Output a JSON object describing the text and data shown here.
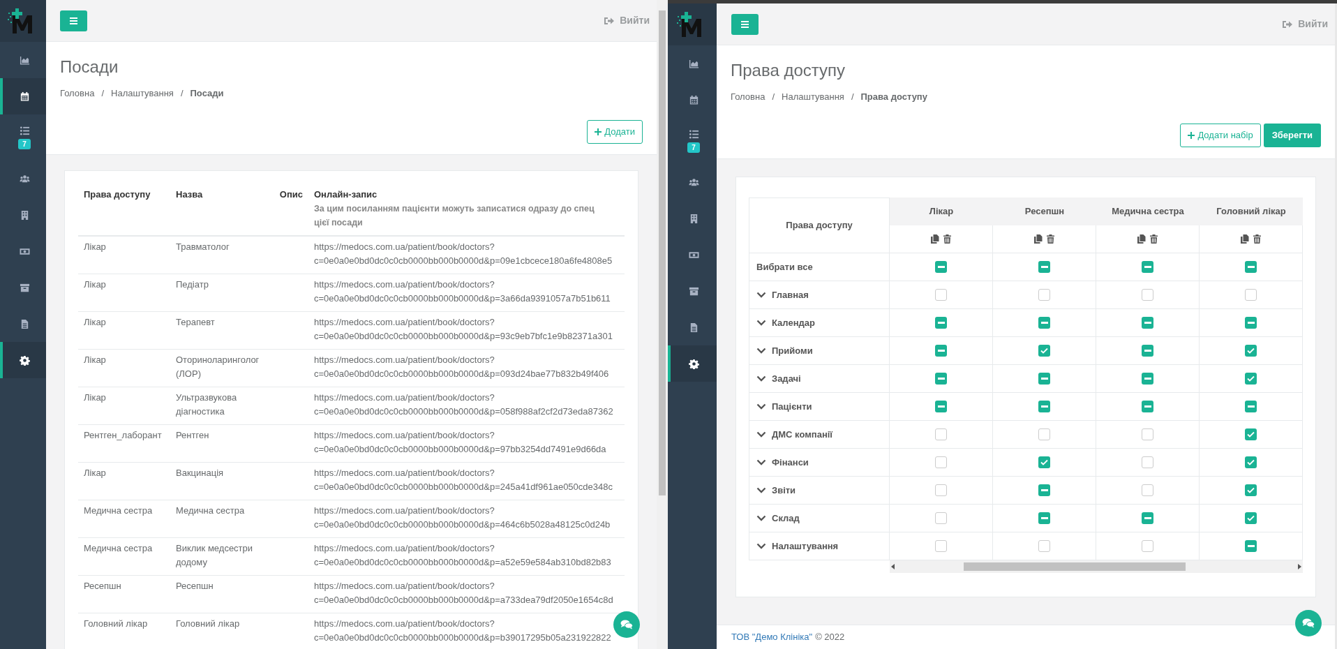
{
  "left_window": {
    "sidebar": {
      "items": [
        {
          "kind": "chart",
          "selected": false
        },
        {
          "kind": "calendar",
          "selected": true
        },
        {
          "kind": "tasks",
          "selected": false,
          "badge": "7"
        },
        {
          "kind": "users",
          "selected": false
        },
        {
          "kind": "building",
          "selected": false
        },
        {
          "kind": "money",
          "selected": false
        },
        {
          "kind": "archive",
          "selected": false
        },
        {
          "kind": "file",
          "selected": false
        },
        {
          "kind": "settings",
          "selected": true
        }
      ]
    },
    "topbar": {
      "logout": "Вийти"
    },
    "page": {
      "title": "Посади",
      "breadcrumb": [
        {
          "label": "Головна",
          "current": false,
          "separator": "/"
        },
        {
          "label": "Налаштування",
          "current": false,
          "separator": "/"
        },
        {
          "label": "Посади",
          "current": true
        }
      ],
      "add_button": "Додати"
    },
    "table": {
      "columns": [
        "Права доступу",
        "Назва",
        "Опис",
        "Онлайн-запис"
      ],
      "online_hint": [
        "За цим посиланням пацієнти можуть записатися одразу до спец",
        "цієї посади"
      ],
      "rows": [
        {
          "access": "Лікар",
          "name": "Травматолог",
          "url": [
            "https://medocs.com.ua/patient/book/doctors?",
            "c=0e0a0e0bd0dc0c0cb0000bb000b0000d&p=09e1cbcece180a6fe4808e5"
          ]
        },
        {
          "access": "Лікар",
          "name": "Педіатр",
          "url": [
            "https://medocs.com.ua/patient/book/doctors?",
            "c=0e0a0e0bd0dc0c0cb0000bb000b0000d&p=3a66da9391057a7b51b611"
          ]
        },
        {
          "access": "Лікар",
          "name": "Терапевт",
          "url": [
            "https://medocs.com.ua/patient/book/doctors?",
            "c=0e0a0e0bd0dc0c0cb0000bb000b0000d&p=93c9eb7bfc1e9b82371a301"
          ]
        },
        {
          "access": "Лікар",
          "name": "Оториноларинголог (ЛОР)",
          "url": [
            "https://medocs.com.ua/patient/book/doctors?",
            "c=0e0a0e0bd0dc0c0cb0000bb000b0000d&p=093d24bae77b832b49f406"
          ]
        },
        {
          "access": "Лікар",
          "name": "Ультразвукова діагностика",
          "url": [
            "https://medocs.com.ua/patient/book/doctors?",
            "c=0e0a0e0bd0dc0c0cb0000bb000b0000d&p=058f988af2cf2d73eda87362"
          ]
        },
        {
          "access": "Рентген_лаборант",
          "name": "Рентген",
          "url": [
            "https://medocs.com.ua/patient/book/doctors?",
            "c=0e0a0e0bd0dc0c0cb0000bb000b0000d&p=97bb3254dd7491e9d66da"
          ]
        },
        {
          "access": "Лікар",
          "name": "Вакцинація",
          "url": [
            "https://medocs.com.ua/patient/book/doctors?",
            "c=0e0a0e0bd0dc0c0cb0000bb000b0000d&p=245a41df961ae050cde348c"
          ]
        },
        {
          "access": "Медична сестра",
          "name": "Медична сестра",
          "url": [
            "https://medocs.com.ua/patient/book/doctors?",
            "c=0e0a0e0bd0dc0c0cb0000bb000b0000d&p=464c6b5028a48125c0d24b"
          ]
        },
        {
          "access": "Медична сестра",
          "name": "Виклик медсестри додому",
          "url": [
            "https://medocs.com.ua/patient/book/doctors?",
            "c=0e0a0e0bd0dc0c0cb0000bb000b0000d&p=a52e59e584ab310bd82b83"
          ]
        },
        {
          "access": "Ресепшн",
          "name": "Ресепшн",
          "url": [
            "https://medocs.com.ua/patient/book/doctors?",
            "c=0e0a0e0bd0dc0c0cb0000bb000b0000d&p=a733dea79df2050e1654c8d"
          ]
        },
        {
          "access": "Головний лікар",
          "name": "Головний лікар",
          "url": [
            "https://medocs.com.ua/patient/book/doctors?",
            "c=0e0a0e0bd0dc0c0cb0000bb000b0000d&p=b39017295b05a231922822"
          ]
        }
      ]
    }
  },
  "right_window": {
    "sidebar": {
      "items": [
        {
          "kind": "chart",
          "selected": false
        },
        {
          "kind": "calendar",
          "selected": false
        },
        {
          "kind": "tasks",
          "selected": false,
          "badge": "7"
        },
        {
          "kind": "users",
          "selected": false
        },
        {
          "kind": "building",
          "selected": false
        },
        {
          "kind": "money",
          "selected": false
        },
        {
          "kind": "archive",
          "selected": false
        },
        {
          "kind": "file",
          "selected": false
        },
        {
          "kind": "settings",
          "selected": true
        }
      ]
    },
    "topbar": {
      "logout": "Вийти"
    },
    "page": {
      "title": "Права доступу",
      "breadcrumb": [
        {
          "label": "Головна",
          "current": false,
          "separator": "/"
        },
        {
          "label": "Налаштування",
          "current": false,
          "separator": "/"
        },
        {
          "label": "Права доступу",
          "current": true
        }
      ],
      "add_button": "Додати набір",
      "save_button": "Зберегти"
    },
    "permissions": {
      "corner": "Права доступу",
      "roles": [
        "Лікар",
        "Ресепшн",
        "Медична сестра",
        "Головний лікар"
      ],
      "rows": [
        {
          "label": "Вибрати все",
          "expandable": false,
          "cells": [
            {
              "checked": true,
              "indeterminate": true
            },
            {
              "checked": true,
              "indeterminate": true
            },
            {
              "checked": true,
              "indeterminate": true
            },
            {
              "checked": true,
              "indeterminate": true
            }
          ]
        },
        {
          "label": "Главная",
          "expandable": true,
          "cells": [
            {
              "checked": false,
              "indeterminate": false
            },
            {
              "checked": false,
              "indeterminate": false
            },
            {
              "checked": false,
              "indeterminate": false
            },
            {
              "checked": false,
              "indeterminate": false
            }
          ]
        },
        {
          "label": "Календар",
          "expandable": true,
          "cells": [
            {
              "checked": true,
              "indeterminate": true
            },
            {
              "checked": true,
              "indeterminate": true
            },
            {
              "checked": true,
              "indeterminate": true
            },
            {
              "checked": true,
              "indeterminate": true
            }
          ]
        },
        {
          "label": "Прийоми",
          "expandable": true,
          "cells": [
            {
              "checked": true,
              "indeterminate": true
            },
            {
              "checked": true,
              "indeterminate": false
            },
            {
              "checked": true,
              "indeterminate": true
            },
            {
              "checked": true,
              "indeterminate": false
            }
          ]
        },
        {
          "label": "Задачі",
          "expandable": true,
          "cells": [
            {
              "checked": true,
              "indeterminate": true
            },
            {
              "checked": true,
              "indeterminate": true
            },
            {
              "checked": true,
              "indeterminate": true
            },
            {
              "checked": true,
              "indeterminate": false
            }
          ]
        },
        {
          "label": "Пацієнти",
          "expandable": true,
          "cells": [
            {
              "checked": true,
              "indeterminate": true
            },
            {
              "checked": true,
              "indeterminate": true
            },
            {
              "checked": true,
              "indeterminate": true
            },
            {
              "checked": true,
              "indeterminate": true
            }
          ]
        },
        {
          "label": "ДМС компанії",
          "expandable": true,
          "cells": [
            {
              "checked": false,
              "indeterminate": false
            },
            {
              "checked": false,
              "indeterminate": false
            },
            {
              "checked": false,
              "indeterminate": false
            },
            {
              "checked": true,
              "indeterminate": false
            }
          ]
        },
        {
          "label": "Фінанси",
          "expandable": true,
          "cells": [
            {
              "checked": false,
              "indeterminate": false
            },
            {
              "checked": true,
              "indeterminate": false
            },
            {
              "checked": false,
              "indeterminate": false
            },
            {
              "checked": true,
              "indeterminate": false
            }
          ]
        },
        {
          "label": "Звіти",
          "expandable": true,
          "cells": [
            {
              "checked": false,
              "indeterminate": false
            },
            {
              "checked": true,
              "indeterminate": true
            },
            {
              "checked": false,
              "indeterminate": false
            },
            {
              "checked": true,
              "indeterminate": false
            }
          ]
        },
        {
          "label": "Склад",
          "expandable": true,
          "cells": [
            {
              "checked": false,
              "indeterminate": false
            },
            {
              "checked": true,
              "indeterminate": true
            },
            {
              "checked": true,
              "indeterminate": true
            },
            {
              "checked": true,
              "indeterminate": false
            }
          ]
        },
        {
          "label": "Налаштування",
          "expandable": true,
          "cells": [
            {
              "checked": false,
              "indeterminate": false
            },
            {
              "checked": false,
              "indeterminate": false
            },
            {
              "checked": false,
              "indeterminate": false
            },
            {
              "checked": true,
              "indeterminate": true
            }
          ]
        }
      ]
    },
    "footer": {
      "company": "ТОВ \"Демо Клініка\"",
      "copyright": "© 2022"
    }
  }
}
